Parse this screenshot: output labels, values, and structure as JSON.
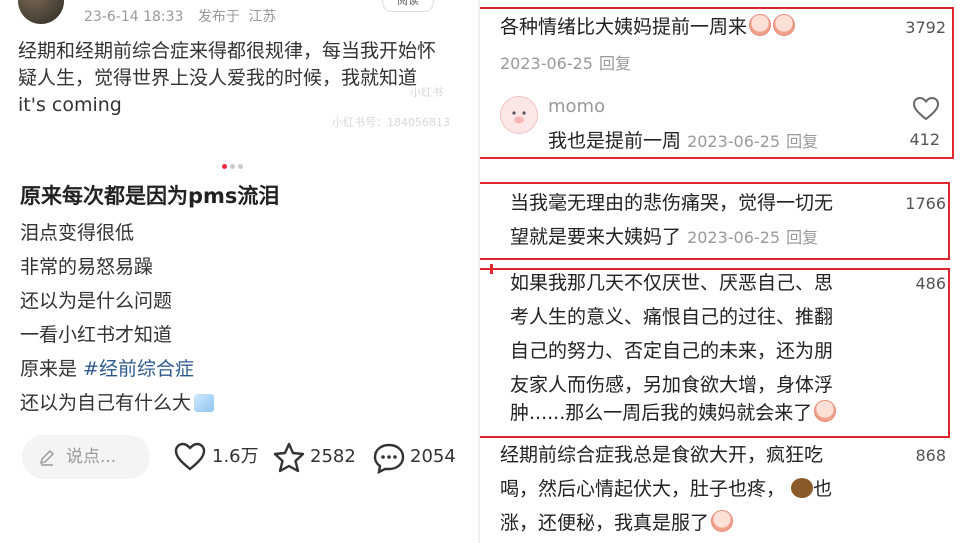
{
  "post": {
    "date": "23-6-14 18:33",
    "location_prefix": "发布于",
    "location": "江苏",
    "read_button": "阅读",
    "text_lines": [
      "经期和经期前综合症来得都很规律，每当我开始怀",
      "疑人生，觉得世界上没人爱我的时候，我就知道",
      "it's coming"
    ],
    "watermark_badge": "小红书",
    "watermark_id": "小红书号：184056813",
    "title": "原来每次都是因为pms流泪",
    "body_lines": [
      "泪点变得很低",
      "非常的易怒易躁",
      "还以为是什么问题",
      "一看小红书才知道"
    ],
    "hashtag_prefix": "原来是 ",
    "hashtag": "#经前综合症",
    "last_line": "还以为自己有什么大"
  },
  "bottom_bar": {
    "comment_placeholder": "说点...",
    "likes": "1.6万",
    "stars": "2582",
    "comments": "2054"
  },
  "comments": [
    {
      "text": "各种情绪比大姨妈提前一周来",
      "date": "2023-06-25",
      "reply_label": "回复",
      "likes": "3792",
      "reply": {
        "name": "momo",
        "text": "我也是提前一周",
        "date": "2023-06-25",
        "reply_label": "回复",
        "likes": "412"
      }
    },
    {
      "lines": [
        "当我毫无理由的悲伤痛哭，觉得一切无",
        "望就是要来大姨妈了"
      ],
      "date": "2023-06-25",
      "reply_label": "回复",
      "likes": "1766"
    },
    {
      "lines": [
        "如果我那几天不仅厌世、厌恶自己、思",
        "考人生的意义、痛恨自己的过往、推翻",
        "自己的努力、否定自己的未来，还为朋",
        "友家人而伤感，另加食欲大增，身体浮",
        "肿......那么一周后我的姨妈就会来了"
      ],
      "likes": "486"
    },
    {
      "lines": [
        "经期前综合症我总是食欲大开，疯狂吃",
        "喝，然后心情起伏大，肚子也疼，",
        "也",
        "涨，还便秘，我真是服了"
      ],
      "likes": "868"
    }
  ],
  "colors": {
    "highlight_border": "#e0262e",
    "hashtag": "#2e5a8f",
    "active_dot": "#ff2442"
  }
}
